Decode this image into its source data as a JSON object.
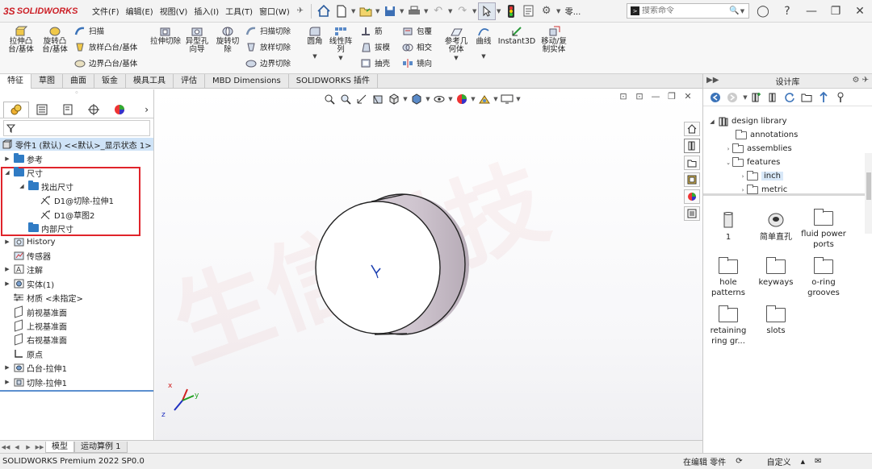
{
  "app": {
    "logo_prefix": "3S",
    "logo_text": "SOLIDWORKS"
  },
  "menu": [
    "文件(F)",
    "编辑(E)",
    "视图(V)",
    "插入(I)",
    "工具(T)",
    "窗口(W)"
  ],
  "toolbar": {
    "dots_label": "零..."
  },
  "search": {
    "placeholder": "搜索命令"
  },
  "commands": {
    "extrude_boss": "拉伸凸台/基体",
    "revolve_boss": "旋转凸台/基体",
    "sweep": "扫描",
    "loft": "放样凸台/基体",
    "boundary": "边界凸台/基体",
    "extrude_cut": "拉伸切除",
    "hole_wizard": "异型孔向导",
    "revolve_cut": "旋转切除",
    "swept_cut": "扫描切除",
    "lofted_cut": "放样切除",
    "boundary_cut": "边界切除",
    "fillet": "圆角",
    "linear_pattern": "线性阵列",
    "rib": "筋",
    "draft": "拔模",
    "shell": "抽壳",
    "wrap": "包覆",
    "intersect": "相交",
    "mirror": "镜向",
    "ref_geometry": "参考几何体",
    "curves": "曲线",
    "instant3d": "Instant3D",
    "move_copy": "移动/复制实体"
  },
  "tabs": [
    "特征",
    "草图",
    "曲面",
    "钣金",
    "模具工具",
    "评估",
    "MBD Dimensions",
    "SOLIDWORKS 插件"
  ],
  "feature_tree": {
    "root": "零件1 (默认) <<默认>_显示状态 1>",
    "items": {
      "ref": "参考",
      "dims": "尺寸",
      "found_dims": "找出尺寸",
      "d1_cut": "D1@切除-拉伸1",
      "d1_sketch": "D1@草图2",
      "internal_dims": "内部尺寸",
      "history": "History",
      "sensors": "传感器",
      "annotations": "注解",
      "solid_bodies": "实体(1)",
      "material": "材质 <未指定>",
      "front_plane": "前视基准面",
      "top_plane": "上视基准面",
      "right_plane": "右视基准面",
      "origin": "原点",
      "boss_extrude": "凸台-拉伸1",
      "cut_extrude": "切除-拉伸1"
    }
  },
  "graphics": {
    "watermark": "生信科技"
  },
  "bottom_tabs": [
    "模型",
    "运动算例 1"
  ],
  "status": {
    "app_version": "SOLIDWORKS Premium 2022 SP0.0",
    "editing": "在编辑 零件",
    "custom": "自定义"
  },
  "design_library": {
    "title": "设计库",
    "tree": {
      "root": "design library",
      "annotations": "annotations",
      "assemblies": "assemblies",
      "features": "features",
      "inch": "inch",
      "metric": "metric"
    },
    "items": [
      "1",
      "简单直孔",
      "fluid power ports",
      "hole patterns",
      "keyways",
      "o-ring grooves",
      "retaining ring gr...",
      "slots"
    ]
  },
  "colors": {
    "accent_red": "#cc1f26",
    "tree_blue": "#2f7bc4",
    "highlight_red": "#e0242b"
  }
}
